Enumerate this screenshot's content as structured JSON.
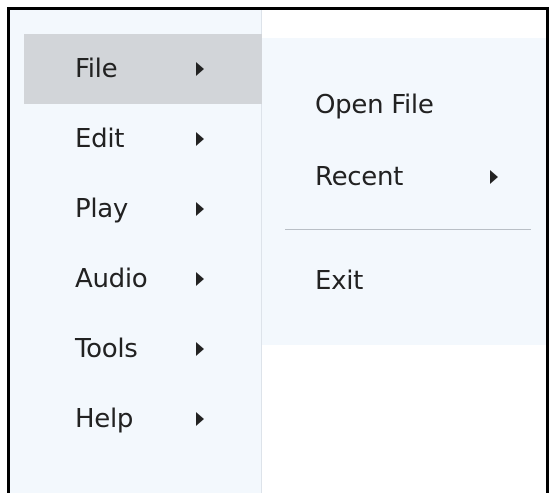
{
  "menu": {
    "items": [
      {
        "label": "File",
        "active": true
      },
      {
        "label": "Edit",
        "active": false
      },
      {
        "label": "Play",
        "active": false
      },
      {
        "label": "Audio",
        "active": false
      },
      {
        "label": "Tools",
        "active": false
      },
      {
        "label": "Help",
        "active": false
      }
    ]
  },
  "submenu": {
    "items": [
      {
        "label": "Open File"
      },
      {
        "label": "Recent"
      },
      {
        "label": "Exit"
      }
    ]
  },
  "colors": {
    "menu_background": "#f3f8fd",
    "active_item_background": "#d2d5d9",
    "text": "#222222",
    "frame_border": "#000000",
    "separator": "#b9bfc6"
  },
  "icons": {
    "submenu_arrow": "caret-right-icon"
  }
}
